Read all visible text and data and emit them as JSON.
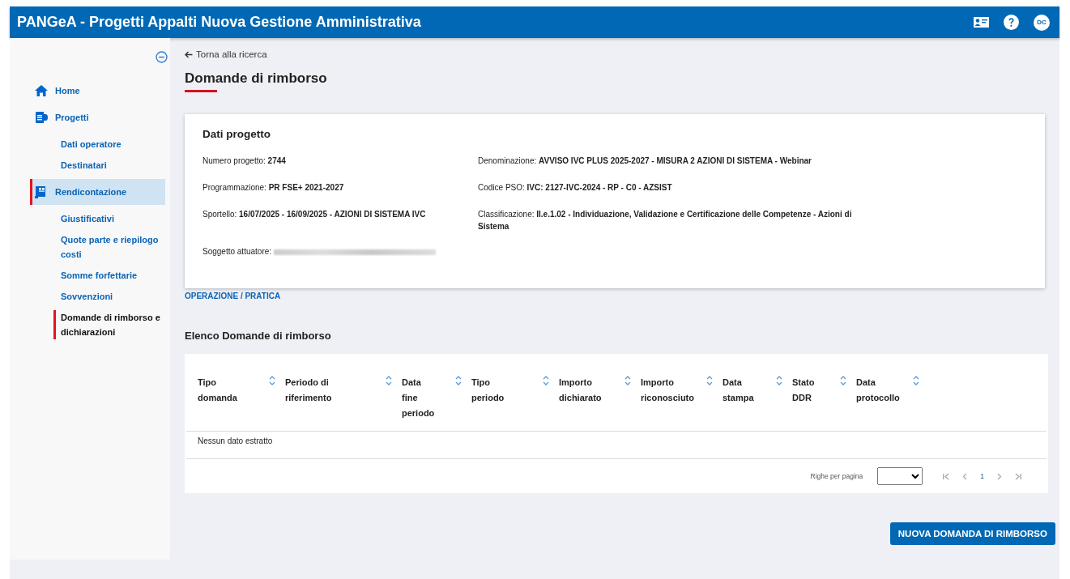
{
  "header": {
    "title": "PANGeA - Progetti Appalti Nuova Gestione Amministrativa",
    "avatar": "DC"
  },
  "sidebar": {
    "items": [
      {
        "kind": "main",
        "label": "Home",
        "selected": false
      },
      {
        "kind": "main",
        "label": "Progetti",
        "selected": false
      },
      {
        "kind": "sub",
        "label": "Dati operatore",
        "selected": false
      },
      {
        "kind": "sub",
        "label": "Destinatari",
        "selected": false
      },
      {
        "kind": "main",
        "label": "Rendicontazione",
        "selected": true
      },
      {
        "kind": "sub",
        "label": "Giustificativi",
        "selected": false
      },
      {
        "kind": "sub",
        "label": "Quote parte e riepilogo costi",
        "selected": false
      },
      {
        "kind": "sub",
        "label": "Somme forfettarie",
        "selected": false
      },
      {
        "kind": "sub",
        "label": "Sovvenzioni",
        "selected": false
      },
      {
        "kind": "sub",
        "label": "Domande di rimborso e dichiarazioni",
        "selected": true
      }
    ]
  },
  "back_link": "Torna alla ricerca",
  "page_title": "Domande di rimborso",
  "project_card": {
    "title": "Dati progetto",
    "left_fields": [
      {
        "label": "Numero progetto:",
        "value": "2744"
      },
      {
        "label": "Programmazione:",
        "value": "PR FSE+ 2021-2027"
      },
      {
        "label": "Sportello:",
        "value": "16/07/2025 - 16/09/2025 - AZIONI DI SISTEMA IVC"
      },
      {
        "label": "Soggetto attuatore:",
        "kind": "redacted"
      }
    ],
    "right_fields": [
      {
        "label": "Denominazione:",
        "value": "AVVISO IVC PLUS 2025-2027 - MISURA 2 AZIONI DI SISTEMA - Webinar"
      },
      {
        "label": "Codice PSO:",
        "value": "IVC: 2127-IVC-2024 - RP - C0 - AZSIST"
      },
      {
        "label": "Classificazione:",
        "value": "II.e.1.02 - Individuazione, Validazione e Certificazione delle Competenze - Azioni di Sistema"
      }
    ]
  },
  "operation_link": "OPERAZIONE / PRATICA",
  "list_title": "Elenco Domande di rimborso",
  "table": {
    "columns": [
      "Tipo domanda",
      "Periodo di riferimento",
      "Data fine periodo",
      "Tipo periodo",
      "Importo dichiarato",
      "Importo riconosciuto",
      "Data stampa",
      "Stato DDR",
      "Data protocollo"
    ],
    "empty_message": "Nessun dato estratto",
    "pagination": {
      "rows_label": "Righe per pagina",
      "page": "1"
    }
  },
  "primary_button": "NUOVA DOMANDA DI RIMBORSO"
}
